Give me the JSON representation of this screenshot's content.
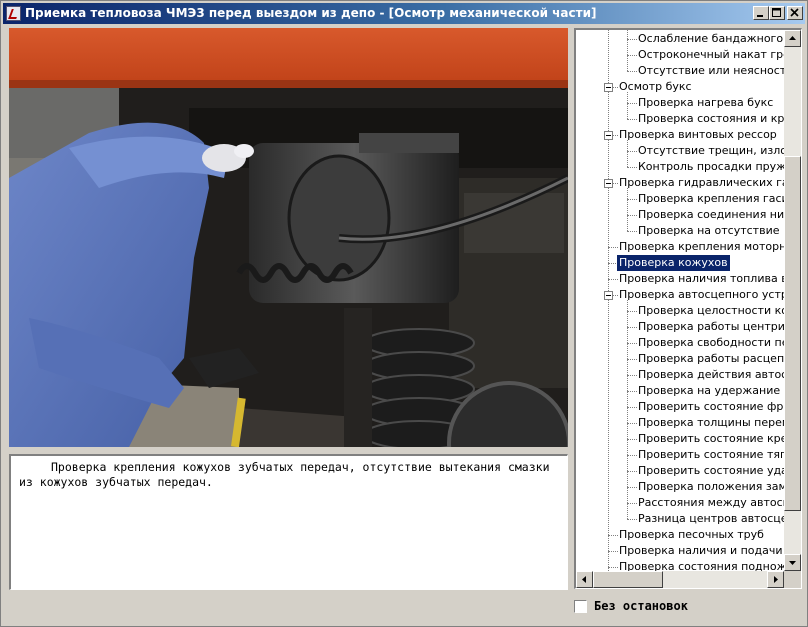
{
  "window": {
    "title": "Приемка тепловоза ЧМЭ3 перед выездом из депо - [Осмотр механической части]",
    "minimize": "0",
    "maximize": "1",
    "close": "r"
  },
  "photo": {
    "icon": "locomotive-bogie-photo"
  },
  "description": "Проверка крепления кожухов зубчатых передач, отсутствие вытекания смазки из кожухов зубчатых передач.",
  "tree": {
    "items": [
      {
        "label": "Ослабление бандажного кол",
        "level": 2
      },
      {
        "label": "Остроконечный накат гребн",
        "level": 2
      },
      {
        "label": "Отсутствие или неясность к",
        "level": 2
      },
      {
        "label": "Осмотр букс",
        "level": 1,
        "expanded": true
      },
      {
        "label": "Проверка нагрева букс",
        "level": 2
      },
      {
        "label": "Проверка состояния и крепл",
        "level": 2
      },
      {
        "label": "Проверка винтовых рессор",
        "level": 1,
        "expanded": true
      },
      {
        "label": "Отсутствие трещин, изломов",
        "level": 2
      },
      {
        "label": "Контроль просадки пружин",
        "level": 2
      },
      {
        "label": "Проверка гидравлических гасит",
        "level": 1,
        "expanded": true
      },
      {
        "label": "Проверка крепления гасите",
        "level": 2
      },
      {
        "label": "Проверка соединения нижне",
        "level": 2
      },
      {
        "label": "Проверка на отсутствие под",
        "level": 2
      },
      {
        "label": "Проверка крепления моторно-ос",
        "level": 1
      },
      {
        "label": "Проверка кожухов",
        "level": 1,
        "selected": true
      },
      {
        "label": "Проверка наличия топлива в ба",
        "level": 1
      },
      {
        "label": "Проверка автосцепного устройс",
        "level": 1,
        "expanded": true
      },
      {
        "label": "Проверка целостности корпу",
        "level": 2
      },
      {
        "label": "Проверка работы центрирую",
        "level": 2
      },
      {
        "label": "Проверка свободности пере",
        "level": 2
      },
      {
        "label": "Проверка работы расцепног",
        "level": 2
      },
      {
        "label": "Проверка действия автосце",
        "level": 2
      },
      {
        "label": "Проверка на удержание зам",
        "level": 2
      },
      {
        "label": "Проверить состояние фрикц",
        "level": 2
      },
      {
        "label": "Проверка толщины перемыч",
        "level": 2
      },
      {
        "label": "Проверить состояние крепле",
        "level": 2
      },
      {
        "label": "Проверить состояние тягово",
        "level": 2
      },
      {
        "label": "Проверить состояние ударно",
        "level": 2
      },
      {
        "label": "Проверка положения замка",
        "level": 2
      },
      {
        "label": "Расстояния между автосцеп",
        "level": 2
      },
      {
        "label": "Разница центров автосцепок",
        "level": 2
      },
      {
        "label": "Проверка песочных труб",
        "level": 1
      },
      {
        "label": "Проверка наличия и подачи песк",
        "level": 1
      },
      {
        "label": "Проверка состояния подножек и",
        "level": 1
      }
    ]
  },
  "scroll": {
    "vertical_position": 0.72,
    "horizontal_position": 0.0
  },
  "no_stops": {
    "label": "Без остановок",
    "checked": false
  },
  "colors": {
    "titlebar_start": "#0a246a",
    "titlebar_end": "#a6caf0",
    "selection": "#0a246a",
    "face": "#d4d0c8"
  }
}
